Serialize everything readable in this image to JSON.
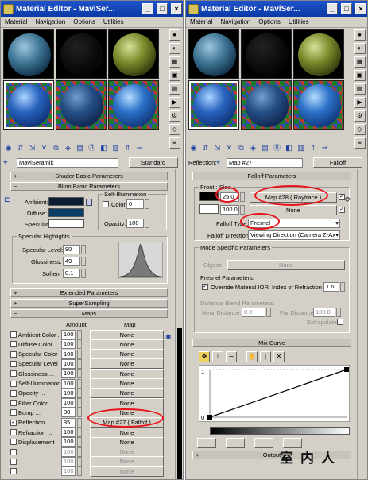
{
  "left": {
    "title": "Material Editor - MaviSer...",
    "menu": [
      "Material",
      "Navigation",
      "Options",
      "Utilities"
    ],
    "material_name": "MaviSeramik",
    "material_type": "Standard",
    "rollouts": {
      "shader_basic": "Shader Basic Parameters",
      "blinn_basic": "Blinn Basic Parameters",
      "extended": "Extended Parameters",
      "supersampling": "SuperSampling",
      "maps": "Maps"
    },
    "blinn": {
      "ambient_label": "Ambient:",
      "diffuse_label": "Diffuse:",
      "specular_label": "Specular:",
      "self_illum_group": "Self-Illumination",
      "color_label": "Color",
      "color_value": "0",
      "opacity_label": "Opacity:",
      "opacity_value": "100",
      "specular_group": "Specular Highlights",
      "spec_level_label": "Specular Level:",
      "spec_level_value": "90",
      "glossiness_label": "Glossiness:",
      "glossiness_value": "49",
      "soften_label": "Soften:",
      "soften_value": "0.1"
    },
    "maps_header": {
      "amount": "Amount",
      "map": "Map"
    },
    "maps": [
      {
        "label": "Ambient Color ...",
        "amount": "100",
        "map": "None",
        "checked": false,
        "dim": false
      },
      {
        "label": "Diffuse Color ...",
        "amount": "100",
        "map": "None",
        "checked": false,
        "dim": false
      },
      {
        "label": "Specular Color ...",
        "amount": "100",
        "map": "None",
        "checked": false,
        "dim": false
      },
      {
        "label": "Specular Level",
        "amount": "100",
        "map": "None",
        "checked": false,
        "dim": false
      },
      {
        "label": "Glossiness ...",
        "amount": "100",
        "map": "None",
        "checked": false,
        "dim": false
      },
      {
        "label": "Self-Illumination",
        "amount": "100",
        "map": "None",
        "checked": false,
        "dim": false
      },
      {
        "label": "Opacity ...",
        "amount": "100",
        "map": "None",
        "checked": false,
        "dim": false
      },
      {
        "label": "Filter Color ...",
        "amount": "100",
        "map": "None",
        "checked": false,
        "dim": false
      },
      {
        "label": "Bump ...",
        "amount": "30",
        "map": "None",
        "checked": false,
        "dim": false
      },
      {
        "label": "Reflection ...",
        "amount": "35",
        "map": "Map #27 ( Falloff )",
        "checked": true,
        "dim": false
      },
      {
        "label": "Refraction ...",
        "amount": "100",
        "map": "None",
        "checked": false,
        "dim": false
      },
      {
        "label": "Displacement",
        "amount": "100",
        "map": "None",
        "checked": false,
        "dim": false
      },
      {
        "label": "",
        "amount": "100",
        "map": "None",
        "checked": false,
        "dim": true
      },
      {
        "label": "",
        "amount": "100",
        "map": "None",
        "checked": false,
        "dim": true
      },
      {
        "label": "",
        "amount": "100",
        "map": "None",
        "checked": false,
        "dim": true
      }
    ]
  },
  "right": {
    "title": "Material Editor - MaviSer...",
    "menu": [
      "Material",
      "Navigation",
      "Options",
      "Utilities"
    ],
    "reflection_label": "Reflection:",
    "map_name": "Map #27",
    "map_type": "Falloff",
    "rollouts": {
      "falloff_params": "Falloff Parameters",
      "mode_specific": "Mode Specific Parameters",
      "mix_curve": "Mix Curve",
      "output": "Output"
    },
    "front_side": {
      "group": "Front : Side",
      "value1": "25.0",
      "map1": "Map #28  ( Raytrace )",
      "value2": "100.0",
      "map2": "None",
      "falloff_type_label": "Falloff Type:",
      "falloff_type": "Fresnel",
      "falloff_dir_label": "Falloff Direction:",
      "falloff_dir": "Viewing Direction (Camera Z-Axis)"
    },
    "mode": {
      "object_label": "Object:",
      "object_value": "None",
      "fresnel_group": "Fresnel Parameters:",
      "override_label": "Override Material IOR",
      "ior_label": "Index of Refraction",
      "ior_value": "1.6",
      "distance_group": "Distance Blend Parameters:",
      "near_label": "Near Distance:",
      "near_value": "0.0",
      "far_label": "Far Distance:",
      "far_value": "100.0",
      "extrapolate_label": "Extrapolate"
    },
    "curve": {
      "y_top": "1",
      "y_bottom": "0"
    }
  },
  "watermark": "室内人",
  "colors": {
    "title_blue": "#0a3aa6",
    "panel_gray": "#d4d0c8",
    "diffuse_swatch": "#0b3e66",
    "highlight_red": "#e8121a"
  }
}
